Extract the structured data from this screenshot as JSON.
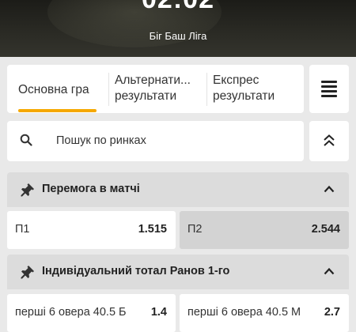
{
  "header": {
    "score": "02:02",
    "league": "Біг Баш Ліга"
  },
  "tabs": [
    {
      "line1": "Основна гра",
      "line2": ""
    },
    {
      "line1": "Альтернати...",
      "line2": "результати"
    },
    {
      "line1": "Експрес",
      "line2": "результати"
    }
  ],
  "search": {
    "placeholder": "Пошук по ринках"
  },
  "markets": [
    {
      "title": "Перемога в матчі",
      "outcomes": [
        {
          "label": "П1",
          "odds": "1.515",
          "selected": false
        },
        {
          "label": "П2",
          "odds": "2.544",
          "selected": true
        }
      ]
    },
    {
      "title": "Індивідуальний тотал Ранов 1-го",
      "outcomes": [
        {
          "label": "перші 6 овера 40.5 Б",
          "odds": "1.4",
          "selected": false
        },
        {
          "label": "перші 6 овера 40.5 М",
          "odds": "2.7",
          "selected": false
        }
      ]
    }
  ],
  "colors": {
    "accent": "#f5a800",
    "header_bg": "#2b2b25",
    "page_bg": "#e9e9e9",
    "market_head_bg": "#dcdcdc",
    "selected_odds_bg": "#d3d3d3"
  },
  "icons": {
    "menu": "list-menu-icon",
    "search": "search-icon",
    "collapse": "double-chevron-up-icon",
    "pin": "pin-icon",
    "chevron": "chevron-up-icon"
  }
}
